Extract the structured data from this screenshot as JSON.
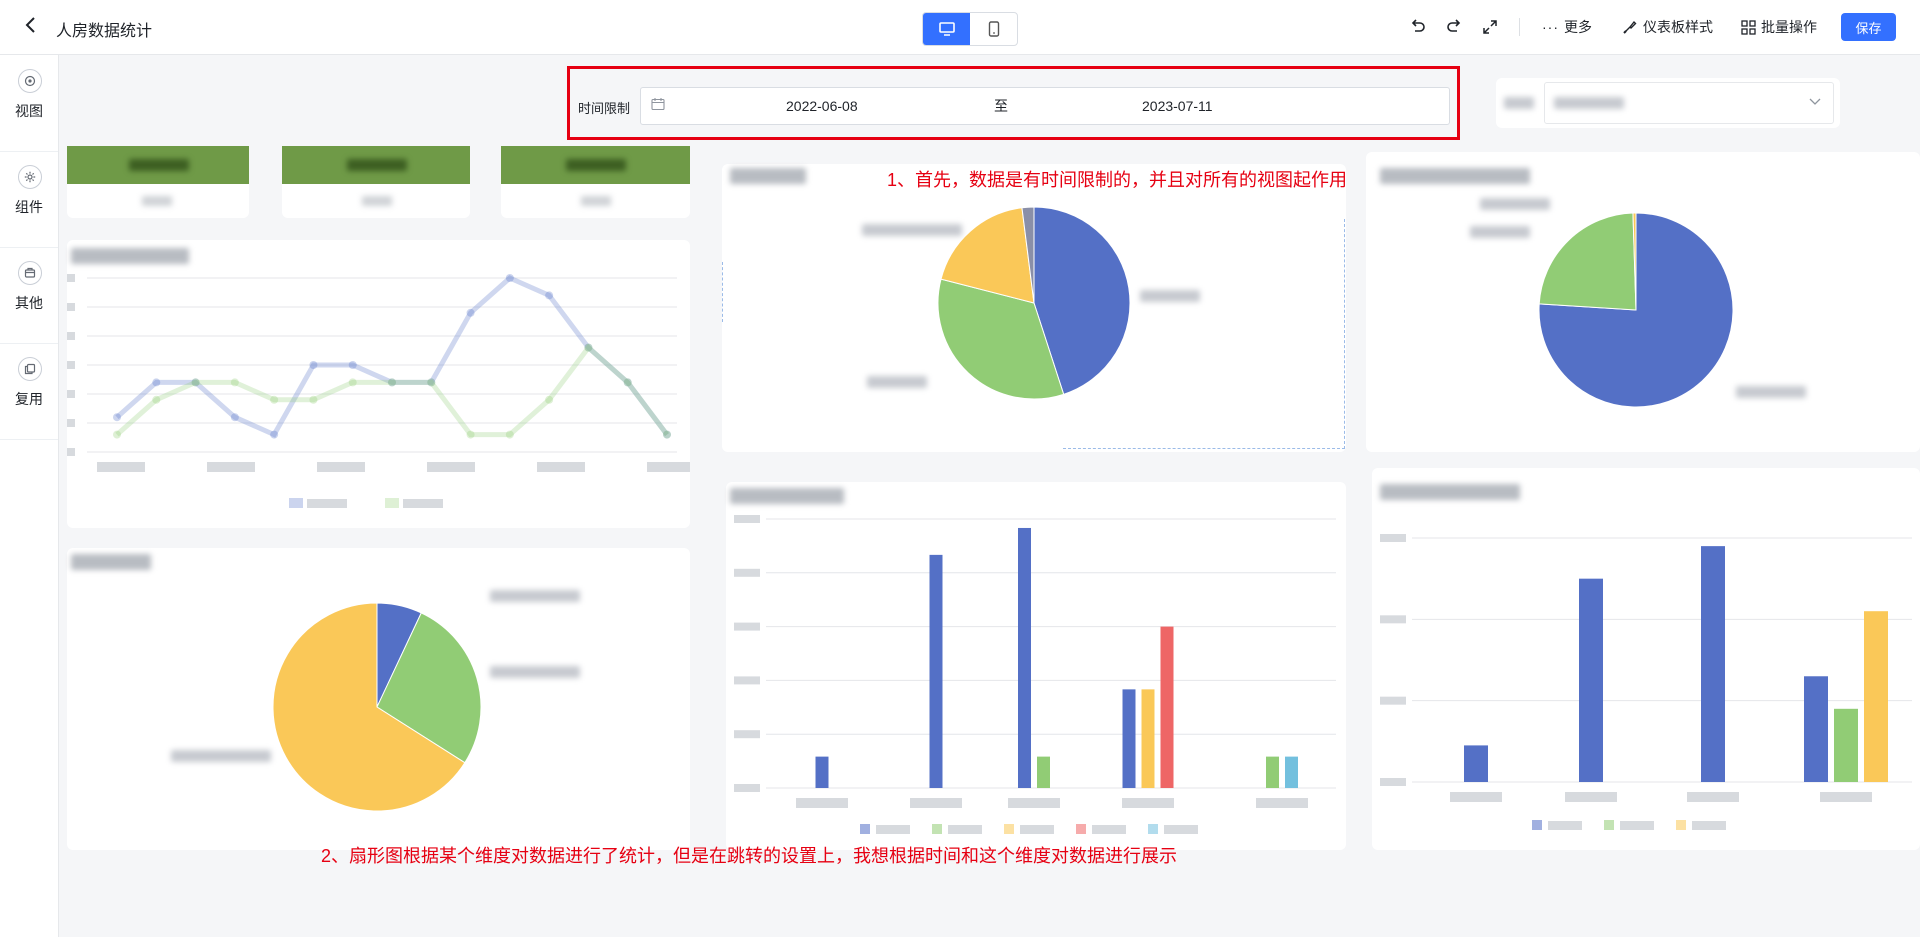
{
  "header": {
    "title": "人房数据统计",
    "more_label": "更多",
    "style_label": "仪表板样式",
    "batch_label": "批量操作",
    "save_label": "保存"
  },
  "sidebar": {
    "items": [
      {
        "label": "视图",
        "icon": "target-icon"
      },
      {
        "label": "组件",
        "icon": "gear-icon"
      },
      {
        "label": "其他",
        "icon": "box-icon"
      },
      {
        "label": "复用",
        "icon": "copy-icon"
      }
    ]
  },
  "filter": {
    "label": "时间限制",
    "start": "2022-06-08",
    "separator": "至",
    "end": "2023-07-11"
  },
  "annotations": {
    "note1": "1、首先，数据是有时间限制的，并且对所有的视图起作用",
    "note2": "2、扇形图根据某个维度对数据进行了统计，但是在跳转的设置上，我想根据时间和这个维度对数据进行展示"
  },
  "colors": {
    "primary": "#3370ff",
    "annotation_red": "#e60012",
    "kpi_green": "#6f9a47",
    "series_blue": "#5470c6",
    "series_green": "#91cc75",
    "series_yellow": "#fac858",
    "series_red": "#ee6666",
    "series_cyan": "#73c0de"
  },
  "chart_data": [
    {
      "type": "pie",
      "slices": [
        {
          "value": 45
        },
        {
          "value": 34
        },
        {
          "value": 19
        },
        {
          "value": 2
        }
      ]
    },
    {
      "type": "pie",
      "slices": [
        {
          "value": 76
        },
        {
          "value": 23.5
        },
        {
          "value": 0.5
        }
      ]
    },
    {
      "type": "pie",
      "slices": [
        {
          "value": 7
        },
        {
          "value": 27
        },
        {
          "value": 66
        }
      ]
    },
    {
      "type": "line",
      "series": [
        {
          "values": [
            2,
            4,
            4,
            2,
            1,
            5,
            5,
            4,
            4,
            8,
            10,
            9,
            6,
            4,
            1
          ]
        },
        {
          "values": [
            1,
            3,
            4,
            4,
            3,
            3,
            4,
            4,
            4,
            1,
            1,
            3,
            6,
            4,
            1
          ]
        }
      ]
    },
    {
      "type": "bar",
      "series": [
        {
          "values": [
            0.7,
            5.2,
            5.8,
            2.2,
            0
          ]
        },
        {
          "values": [
            0,
            0,
            0.7,
            0,
            0.7
          ]
        },
        {
          "values": [
            0,
            0,
            0,
            2.2,
            0
          ]
        },
        {
          "values": [
            0,
            0,
            0,
            3.6,
            0
          ]
        },
        {
          "values": [
            0,
            0,
            0,
            0,
            0.7
          ]
        }
      ],
      "ylim": [
        0,
        6
      ]
    },
    {
      "type": "bar",
      "series": [
        {
          "values": [
            0.45,
            2.5,
            2.9,
            1.3
          ]
        },
        {
          "values": [
            0,
            0,
            0,
            0.9
          ]
        },
        {
          "values": [
            0,
            0,
            0,
            2.1
          ]
        }
      ],
      "ylim": [
        0,
        3
      ]
    }
  ]
}
